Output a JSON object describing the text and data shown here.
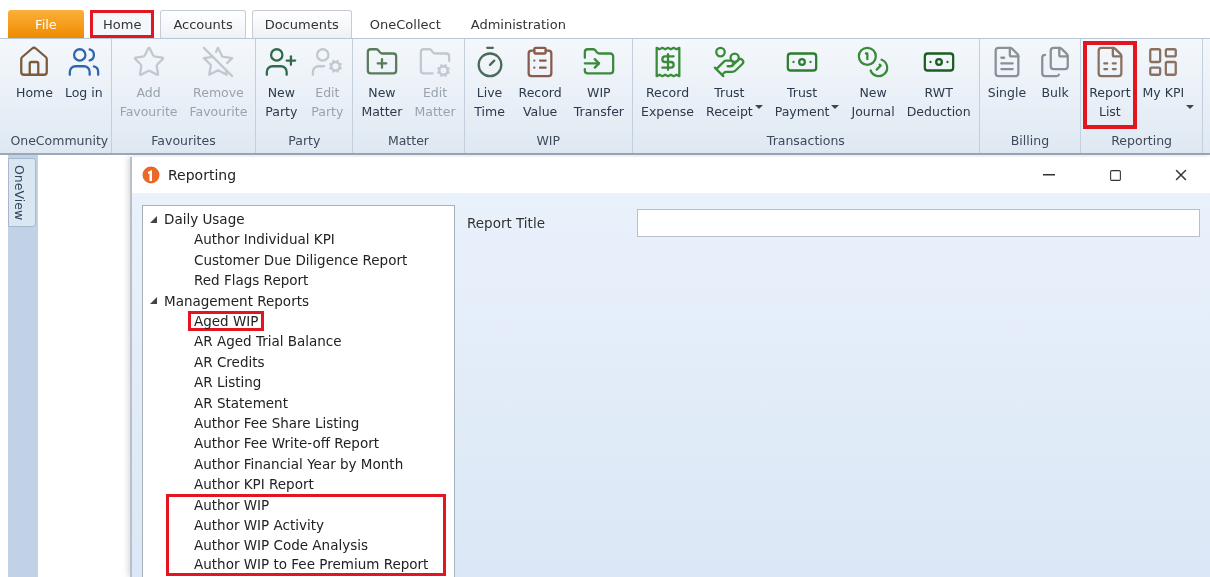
{
  "tabs": [
    {
      "label": "File",
      "kind": "file",
      "selected": false,
      "highlighted": false
    },
    {
      "label": "Home",
      "kind": "standard",
      "selected": true,
      "highlighted": true
    },
    {
      "label": "Accounts",
      "kind": "outlined",
      "selected": false,
      "highlighted": false
    },
    {
      "label": "Documents",
      "kind": "outlined",
      "selected": false,
      "highlighted": false
    },
    {
      "label": "OneCollect",
      "kind": "standard",
      "selected": false,
      "highlighted": false
    },
    {
      "label": "Administration",
      "kind": "standard",
      "selected": false,
      "highlighted": false
    }
  ],
  "ribbon_groups": [
    {
      "label": "OneCommunity",
      "buttons": [
        {
          "lines": [
            "Home"
          ],
          "disabled": false,
          "highlighted": false
        },
        {
          "lines": [
            "Log in"
          ],
          "disabled": false,
          "highlighted": false
        }
      ]
    },
    {
      "label": "Favourites",
      "buttons": [
        {
          "lines": [
            "Add",
            "Favourite"
          ],
          "disabled": true,
          "highlighted": false
        },
        {
          "lines": [
            "Remove",
            "Favourite"
          ],
          "disabled": true,
          "highlighted": false
        }
      ]
    },
    {
      "label": "Party",
      "buttons": [
        {
          "lines": [
            "New",
            "Party"
          ],
          "disabled": false,
          "highlighted": false
        },
        {
          "lines": [
            "Edit",
            "Party"
          ],
          "disabled": true,
          "highlighted": false
        }
      ]
    },
    {
      "label": "Matter",
      "buttons": [
        {
          "lines": [
            "New",
            "Matter"
          ],
          "disabled": false,
          "highlighted": false
        },
        {
          "lines": [
            "Edit",
            "Matter"
          ],
          "disabled": true,
          "highlighted": false
        }
      ]
    },
    {
      "label": "WIP",
      "buttons": [
        {
          "lines": [
            "Live",
            "Time"
          ],
          "disabled": false,
          "highlighted": false
        },
        {
          "lines": [
            "Record",
            "Value"
          ],
          "disabled": false,
          "highlighted": false
        },
        {
          "lines": [
            "WIP",
            "Transfer"
          ],
          "disabled": false,
          "highlighted": false
        }
      ]
    },
    {
      "label": "Transactions",
      "buttons": [
        {
          "lines": [
            "Record",
            "Expense"
          ],
          "disabled": false,
          "highlighted": false
        },
        {
          "lines": [
            "Trust",
            "Receipt"
          ],
          "disabled": false,
          "highlighted": false,
          "dropdown": true
        },
        {
          "lines": [
            "Trust",
            "Payment"
          ],
          "disabled": false,
          "highlighted": false,
          "dropdown": true
        },
        {
          "lines": [
            "New",
            "Journal"
          ],
          "disabled": false,
          "highlighted": false
        },
        {
          "lines": [
            "RWT",
            "Deduction"
          ],
          "disabled": false,
          "highlighted": false
        }
      ]
    },
    {
      "label": "Billing",
      "buttons": [
        {
          "lines": [
            "Single"
          ],
          "disabled": false,
          "highlighted": false
        },
        {
          "lines": [
            "Bulk"
          ],
          "disabled": false,
          "highlighted": false
        }
      ]
    },
    {
      "label": "Reporting",
      "buttons": [
        {
          "lines": [
            "Report",
            "List"
          ],
          "disabled": false,
          "highlighted": true
        },
        {
          "lines": [
            "My KPI"
          ],
          "disabled": false,
          "highlighted": false,
          "dropdown": true
        }
      ]
    }
  ],
  "side_tab": {
    "label": "OneView"
  },
  "dialog": {
    "title": "Reporting",
    "tree": [
      {
        "label": "Daily Usage",
        "expanded": true,
        "children": [
          {
            "label": "Author Individual KPI",
            "highlighted": false
          },
          {
            "label": "Customer Due Diligence Report",
            "highlighted": false
          },
          {
            "label": "Red Flags Report",
            "highlighted": false
          }
        ]
      },
      {
        "label": "Management Reports",
        "expanded": true,
        "children": [
          {
            "label": "Aged WIP",
            "highlighted": true
          },
          {
            "label": "AR Aged Trial Balance",
            "highlighted": false
          },
          {
            "label": "AR Credits",
            "highlighted": false
          },
          {
            "label": "AR Listing",
            "highlighted": false
          },
          {
            "label": "AR Statement",
            "highlighted": false
          },
          {
            "label": "Author Fee Share Listing",
            "highlighted": false
          },
          {
            "label": "Author Fee Write-off Report",
            "highlighted": false
          },
          {
            "label": "Author Financial Year by Month",
            "highlighted": false
          },
          {
            "label": "Author KPI Report",
            "highlighted": false
          },
          {
            "label": "Author WIP",
            "highlighted": true
          },
          {
            "label": "Author WIP Activity",
            "highlighted": true
          },
          {
            "label": "Author WIP Code Analysis",
            "highlighted": true
          },
          {
            "label": "Author WIP to Fee Premium Report",
            "highlighted": true
          }
        ]
      }
    ],
    "report_title": {
      "label": "Report Title"
    }
  }
}
